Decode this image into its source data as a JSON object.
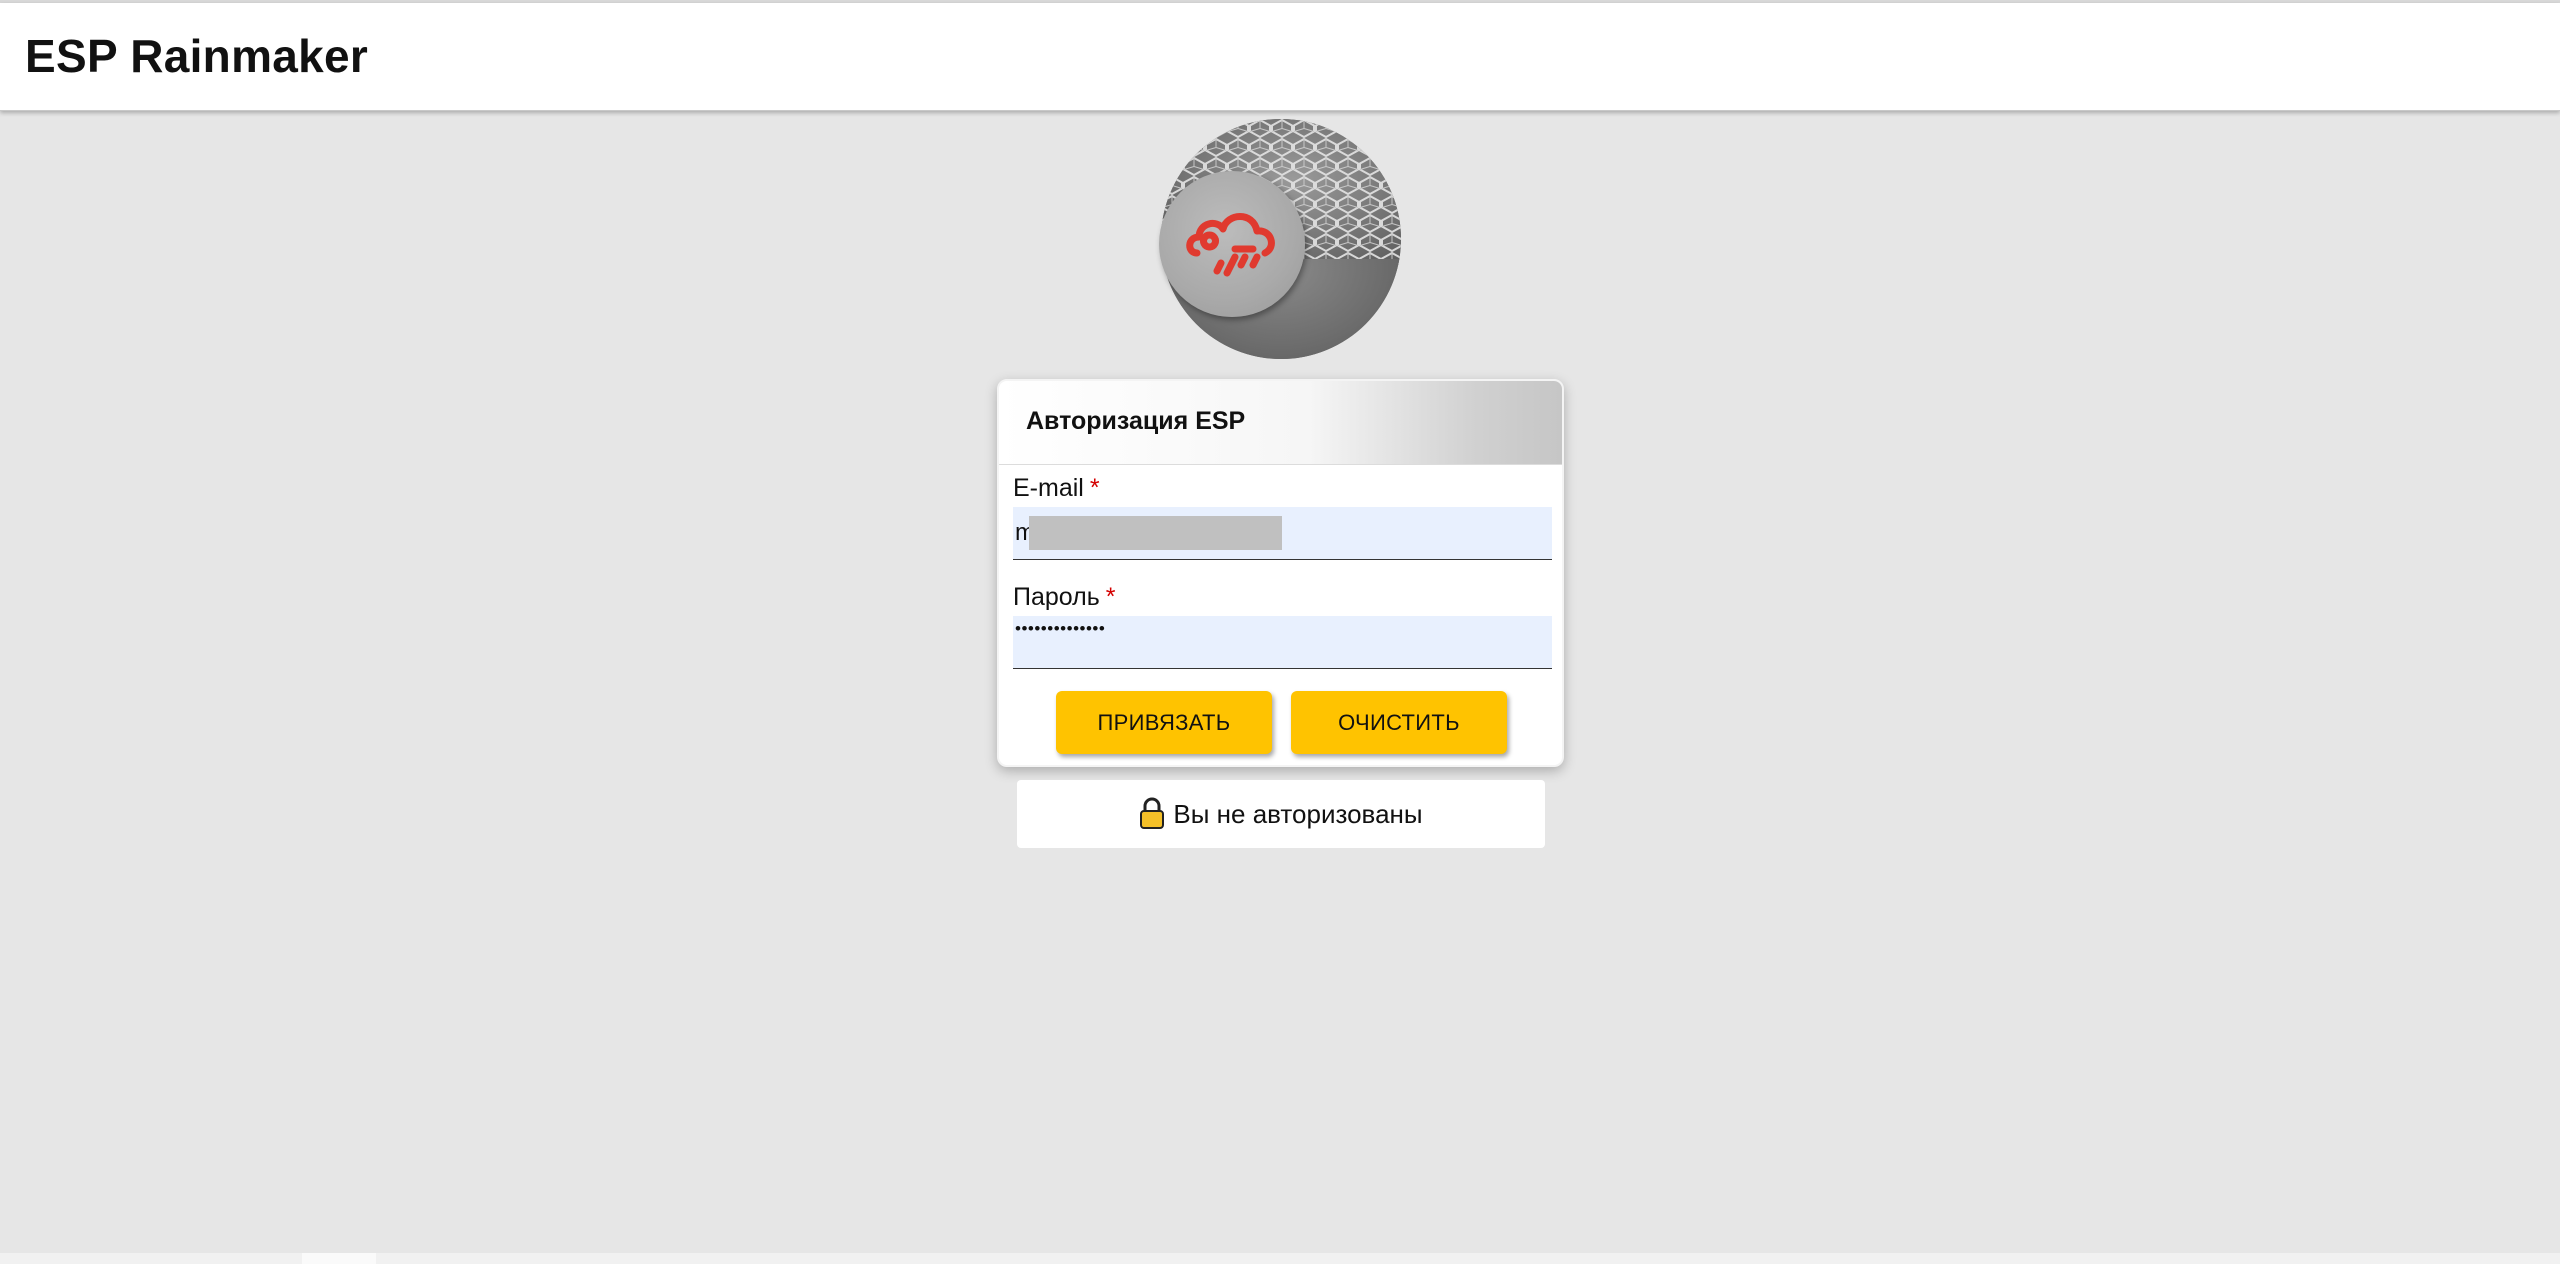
{
  "header": {
    "title": "ESP Rainmaker"
  },
  "logo": {
    "icon": "rainmaker-cloud-icon",
    "accent": "#e03a2f"
  },
  "card": {
    "title": "Авторизация ESP",
    "email_label": "E-mail",
    "email_value": "m",
    "password_label": "Пароль",
    "password_value": "••••••••••••••",
    "required_mark": "*",
    "bind_button": "ПРИВЯЗАТЬ",
    "clear_button": "ОЧИСТИТЬ"
  },
  "status": {
    "text": "Вы не авторизованы",
    "icon": "lock-icon"
  },
  "colors": {
    "button": "#ffc300",
    "input_bg": "#e8f0fe",
    "page_bg": "#e6e6e6"
  }
}
